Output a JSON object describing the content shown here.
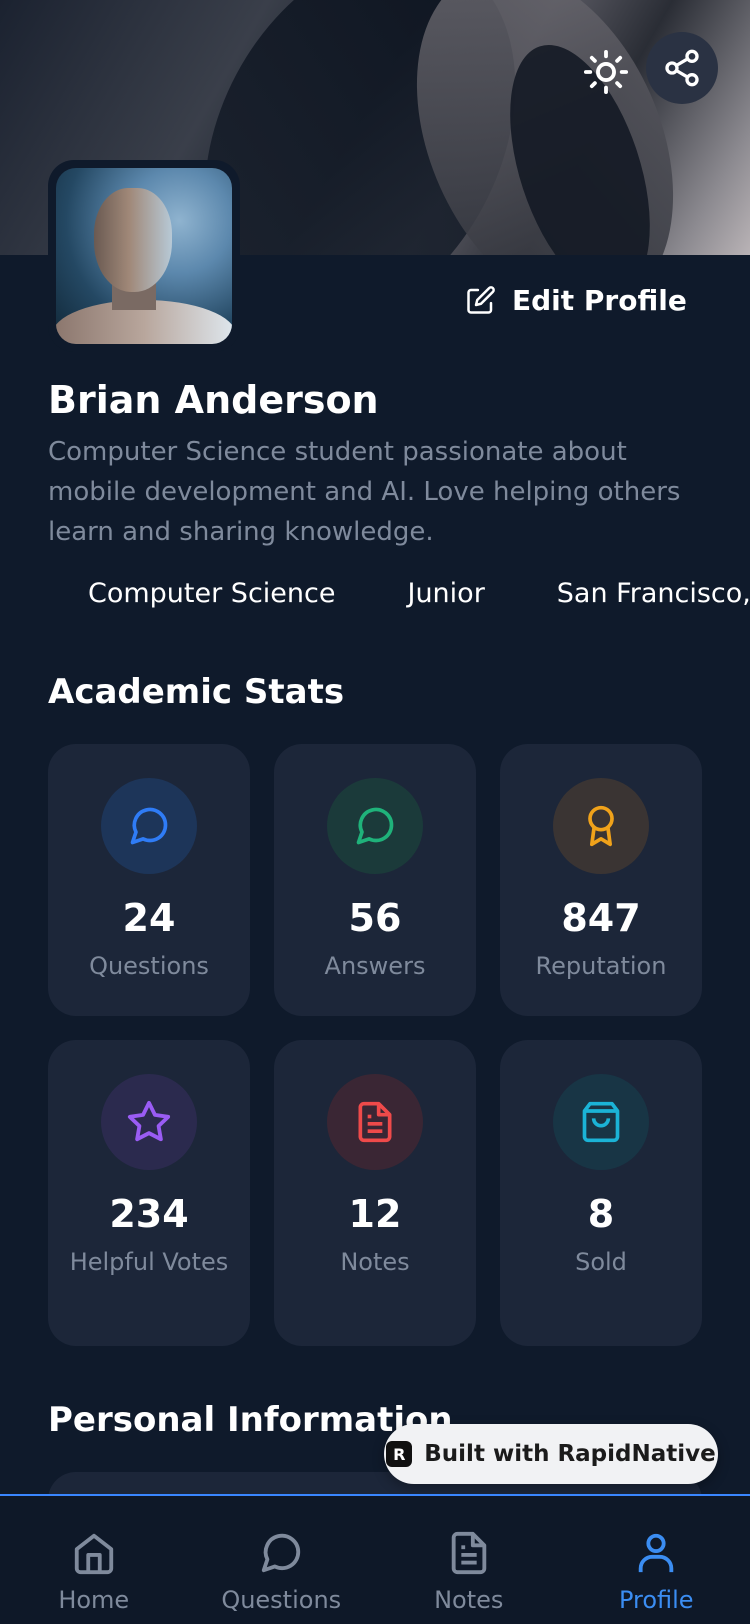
{
  "header": {
    "theme_icon": "sun-icon",
    "share_icon": "share-icon"
  },
  "profile": {
    "edit_label": "Edit Profile",
    "name": "Brian Anderson",
    "bio": "Computer Science student passionate about mobile development and AI. Love helping others learn and sharing knowledge.",
    "tags": [
      "Computer Science",
      "Junior",
      "San Francisco, C"
    ]
  },
  "stats": {
    "title": "Academic Stats",
    "items": [
      {
        "value": "24",
        "label": "Questions",
        "icon": "chat-bubble-icon",
        "color": "#2f7cf6",
        "bg": "#1d3559"
      },
      {
        "value": "56",
        "label": "Answers",
        "icon": "chat-bubble-icon",
        "color": "#1fb27a",
        "bg": "#1b3a3a"
      },
      {
        "value": "847",
        "label": "Reputation",
        "icon": "award-icon",
        "color": "#f0a21a",
        "bg": "#3a3433"
      },
      {
        "value": "234",
        "label": "Helpful Votes",
        "icon": "star-icon",
        "color": "#9a5cf4",
        "bg": "#2b2a4e"
      },
      {
        "value": "12",
        "label": "Notes",
        "icon": "document-icon",
        "color": "#ef4a4a",
        "bg": "#3a2634"
      },
      {
        "value": "8",
        "label": "Sold",
        "icon": "shopping-bag-icon",
        "color": "#1bb3d6",
        "bg": "#183545"
      }
    ]
  },
  "personal": {
    "title": "Personal Information"
  },
  "badge": {
    "text": "Built with RapidNative"
  },
  "tabs": [
    {
      "label": "Home",
      "icon": "home-icon"
    },
    {
      "label": "Questions",
      "icon": "chat-bubble-icon"
    },
    {
      "label": "Notes",
      "icon": "document-icon"
    },
    {
      "label": "Profile",
      "icon": "user-icon",
      "active": true
    }
  ],
  "colors": {
    "accent": "#3b8df2",
    "background": "#0f1a2b",
    "card": "#1c2639",
    "muted_text": "#7f8a9c"
  }
}
